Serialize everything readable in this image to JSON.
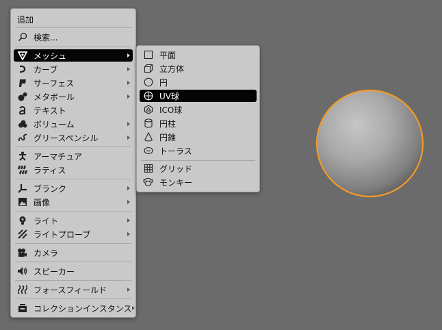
{
  "add_menu": {
    "title": "追加",
    "search_label": "検索...",
    "items": [
      {
        "label": "メッシュ"
      },
      {
        "label": "カーブ"
      },
      {
        "label": "サーフェス"
      },
      {
        "label": "メタボール"
      },
      {
        "label": "テキスト"
      },
      {
        "label": "ボリューム"
      },
      {
        "label": "グリースペンシル"
      },
      {
        "label": "アーマチュア"
      },
      {
        "label": "ラティス"
      },
      {
        "label": "ブランク"
      },
      {
        "label": "画像"
      },
      {
        "label": "ライト"
      },
      {
        "label": "ライトプローブ"
      },
      {
        "label": "カメラ"
      },
      {
        "label": "スピーカー"
      },
      {
        "label": "フォースフィールド"
      },
      {
        "label": "コレクションインスタンス"
      }
    ]
  },
  "mesh_menu": {
    "items": [
      {
        "label": "平面"
      },
      {
        "label": "立方体"
      },
      {
        "label": "円"
      },
      {
        "label": "UV球"
      },
      {
        "label": "ICO球"
      },
      {
        "label": "円柱"
      },
      {
        "label": "円錐"
      },
      {
        "label": "トーラス"
      },
      {
        "label": "グリッド"
      },
      {
        "label": "モンキー"
      }
    ]
  },
  "icons": {
    "search": "search-icon",
    "mesh": "mesh-icon",
    "curve": "curve-icon",
    "surface": "surface-icon",
    "metaball": "metaball-icon",
    "text": "text-icon",
    "volume": "volume-icon",
    "grease_pencil": "grease-pencil-icon",
    "armature": "armature-icon",
    "lattice": "lattice-icon",
    "empty": "empty-icon",
    "image": "image-icon",
    "light": "light-icon",
    "light_probe": "light-probe-icon",
    "camera": "camera-icon",
    "speaker": "speaker-icon",
    "force_field": "force-field-icon",
    "collection_instance": "collection-icon"
  },
  "colors": {
    "menu_bg": "#c9c9c9",
    "highlight_bg": "#050505",
    "selection_outline": "#f39a28",
    "viewport_bg": "#6b6b6b"
  }
}
